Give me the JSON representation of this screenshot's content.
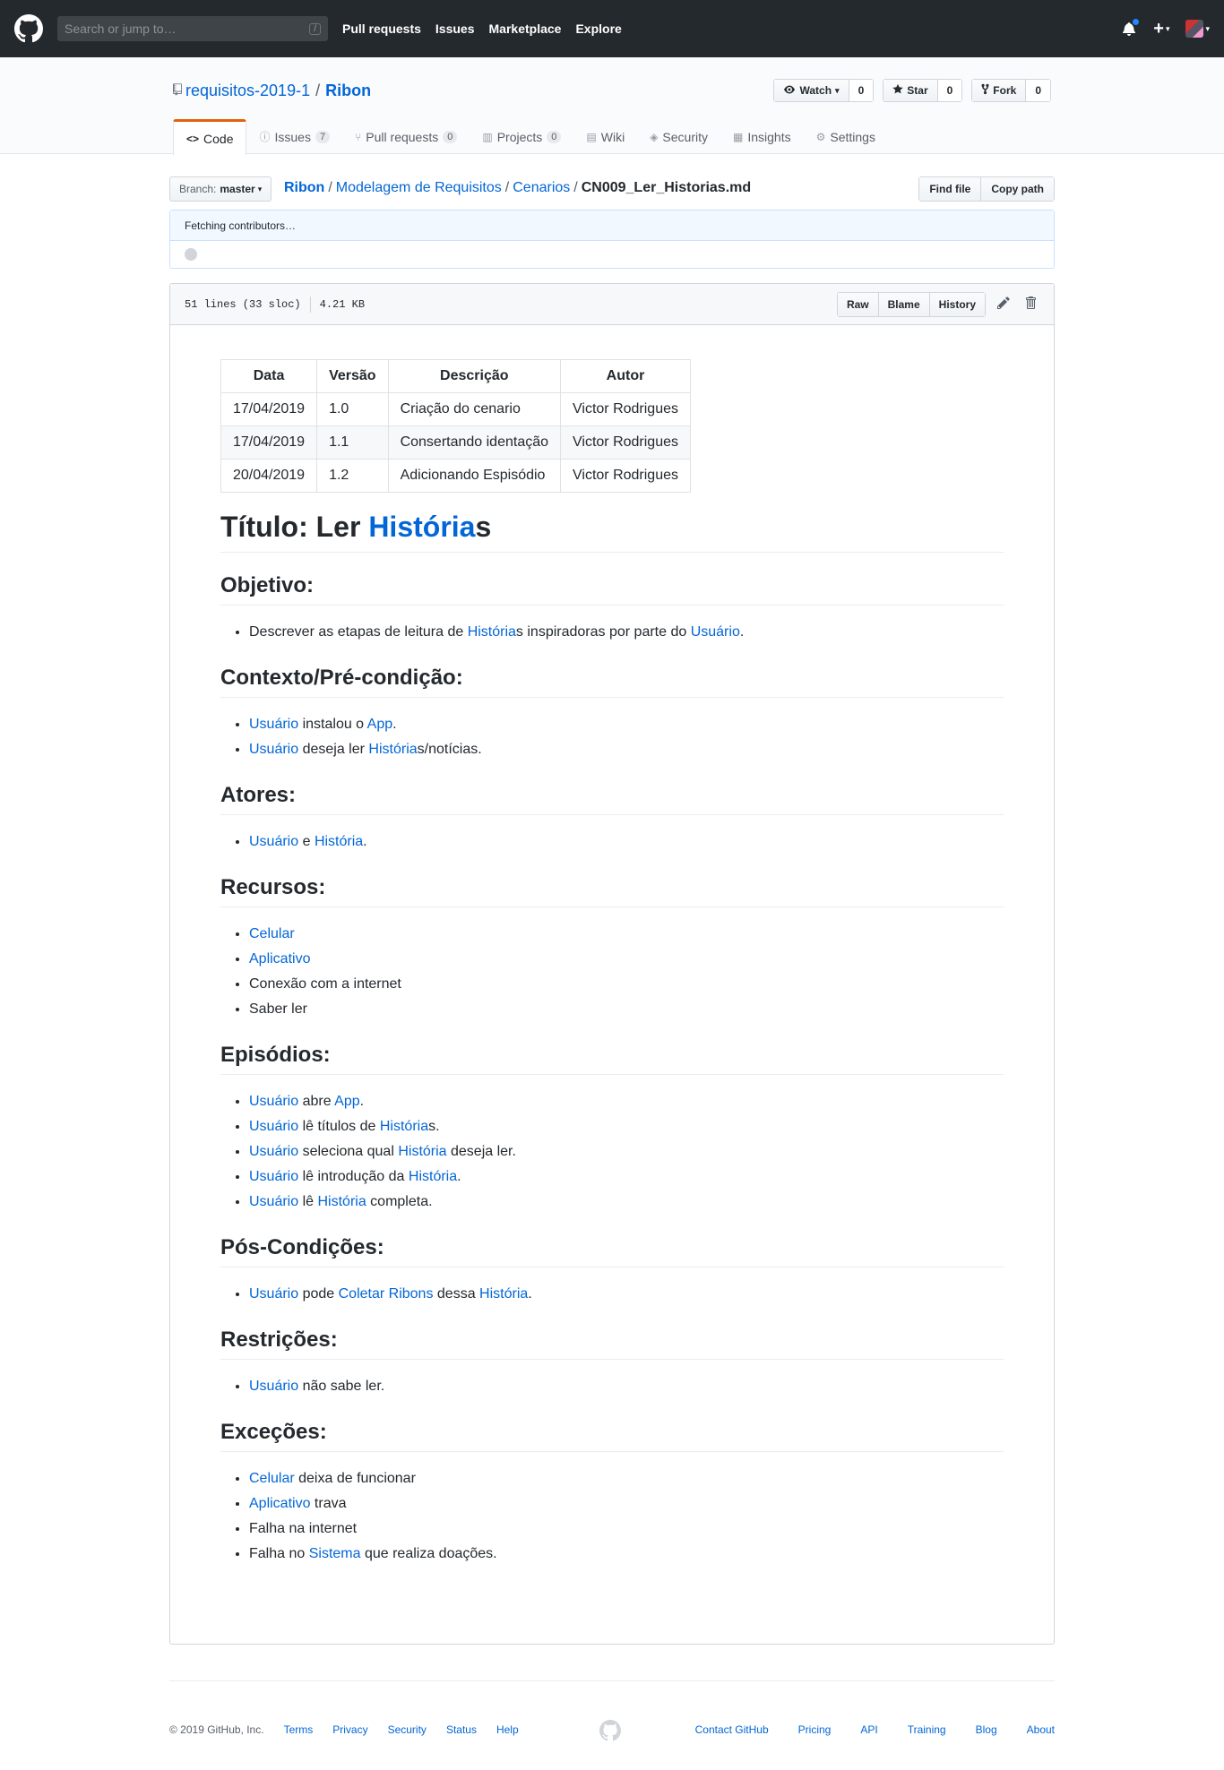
{
  "topnav": {
    "search_placeholder": "Search or jump to…",
    "slash_hint": "/",
    "links": [
      "Pull requests",
      "Issues",
      "Marketplace",
      "Explore"
    ],
    "plus": "+",
    "caret": "▾"
  },
  "repo": {
    "owner": "requisitos-2019-1",
    "separator": "/",
    "name": "Ribon",
    "watch_label": "Watch",
    "watch_count": "0",
    "star_label": "Star",
    "star_count": "0",
    "fork_label": "Fork",
    "fork_count": "0"
  },
  "tabs": [
    {
      "label": "Code",
      "icon": "code-icon"
    },
    {
      "label": "Issues",
      "count": "7",
      "icon": "issue-icon"
    },
    {
      "label": "Pull requests",
      "count": "0",
      "icon": "pr-icon"
    },
    {
      "label": "Projects",
      "count": "0",
      "icon": "project-icon"
    },
    {
      "label": "Wiki",
      "icon": "book-icon"
    },
    {
      "label": "Security",
      "icon": "shield-icon"
    },
    {
      "label": "Insights",
      "icon": "graph-icon"
    },
    {
      "label": "Settings",
      "icon": "gear-icon"
    }
  ],
  "filebar": {
    "branch_prefix": "Branch:",
    "branch": "master",
    "crumbs": [
      "Ribon",
      "Modelagem de Requisitos",
      "Cenarios"
    ],
    "filename": "CN009_Ler_Historias.md",
    "find_file": "Find file",
    "copy_path": "Copy path"
  },
  "contributors": {
    "text": "Fetching contributors…"
  },
  "file": {
    "lines": "51 lines (33 sloc)",
    "size": "4.21 KB",
    "raw": "Raw",
    "blame": "Blame",
    "history": "History"
  },
  "doc": {
    "table": {
      "headers": [
        "Data",
        "Versão",
        "Descrição",
        "Autor"
      ],
      "rows": [
        [
          "17/04/2019",
          "1.0",
          "Criação do cenario",
          "Victor Rodrigues"
        ],
        [
          "17/04/2019",
          "1.1",
          "Consertando identação",
          "Victor Rodrigues"
        ],
        [
          "20/04/2019",
          "1.2",
          "Adicionando Espisódio",
          "Victor Rodrigues"
        ]
      ]
    },
    "title_prefix": "Título: Ler ",
    "title_link": "História",
    "title_suffix": "s",
    "sections": [
      {
        "heading": "Objetivo:",
        "items": [
          [
            {
              "t": "Descrever as etapas de leitura de "
            },
            {
              "l": "História"
            },
            {
              "t": "s inspiradoras por parte do "
            },
            {
              "l": "Usuário"
            },
            {
              "t": "."
            }
          ]
        ]
      },
      {
        "heading": "Contexto/Pré-condição:",
        "items": [
          [
            {
              "l": "Usuário"
            },
            {
              "t": " instalou o "
            },
            {
              "l": "App"
            },
            {
              "t": "."
            }
          ],
          [
            {
              "l": "Usuário"
            },
            {
              "t": " deseja ler "
            },
            {
              "l": "História"
            },
            {
              "t": "s/notícias."
            }
          ]
        ]
      },
      {
        "heading": "Atores:",
        "items": [
          [
            {
              "l": "Usuário"
            },
            {
              "t": " e "
            },
            {
              "l": "História"
            },
            {
              "t": "."
            }
          ]
        ]
      },
      {
        "heading": "Recursos:",
        "items": [
          [
            {
              "l": "Celular"
            }
          ],
          [
            {
              "l": "Aplicativo"
            }
          ],
          [
            {
              "t": "Conexão com a internet"
            }
          ],
          [
            {
              "t": "Saber ler"
            }
          ]
        ]
      },
      {
        "heading": "Episódios:",
        "items": [
          [
            {
              "l": "Usuário"
            },
            {
              "t": " abre "
            },
            {
              "l": "App"
            },
            {
              "t": "."
            }
          ],
          [
            {
              "l": "Usuário"
            },
            {
              "t": " lê títulos de "
            },
            {
              "l": "História"
            },
            {
              "t": "s."
            }
          ],
          [
            {
              "l": "Usuário"
            },
            {
              "t": " seleciona qual "
            },
            {
              "l": "História"
            },
            {
              "t": " deseja ler."
            }
          ],
          [
            {
              "l": "Usuário"
            },
            {
              "t": " lê introdução da "
            },
            {
              "l": "História"
            },
            {
              "t": "."
            }
          ],
          [
            {
              "l": "Usuário"
            },
            {
              "t": " lê "
            },
            {
              "l": "História"
            },
            {
              "t": " completa."
            }
          ]
        ]
      },
      {
        "heading": "Pós-Condições:",
        "items": [
          [
            {
              "l": "Usuário"
            },
            {
              "t": " pode "
            },
            {
              "l": "Coletar Ribons"
            },
            {
              "t": " dessa "
            },
            {
              "l": "História"
            },
            {
              "t": "."
            }
          ]
        ]
      },
      {
        "heading": "Restrições:",
        "items": [
          [
            {
              "l": "Usuário"
            },
            {
              "t": " não sabe ler."
            }
          ]
        ]
      },
      {
        "heading": "Exceções:",
        "items": [
          [
            {
              "l": "Celular"
            },
            {
              "t": " deixa de funcionar"
            }
          ],
          [
            {
              "l": "Aplicativo"
            },
            {
              "t": " trava"
            }
          ],
          [
            {
              "t": "Falha na internet"
            }
          ],
          [
            {
              "t": "Falha no "
            },
            {
              "l": "Sistema"
            },
            {
              "t": " que realiza doações."
            }
          ]
        ]
      }
    ]
  },
  "footer": {
    "copyright": "© 2019 GitHub, Inc.",
    "left_links": [
      "Terms",
      "Privacy",
      "Security",
      "Status",
      "Help"
    ],
    "right_links": [
      "Contact GitHub",
      "Pricing",
      "API",
      "Training",
      "Blog",
      "About"
    ]
  },
  "colors": {
    "link": "#0366d6",
    "header_bg": "#24292e",
    "tab_accent": "#e36209"
  }
}
